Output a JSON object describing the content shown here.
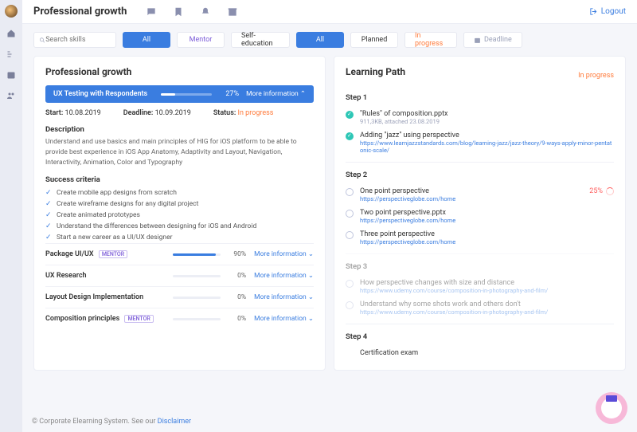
{
  "header": {
    "title": "Professional growth",
    "logout": "Logout"
  },
  "search": {
    "placeholder": "Search skills"
  },
  "filters1": {
    "all": "All",
    "mentor": "Mentor",
    "self": "Self-education"
  },
  "filters2": {
    "all": "All",
    "planned": "Planned",
    "inprog": "In progress",
    "deadline": "Deadline"
  },
  "left": {
    "title": "Professional growth",
    "primary": {
      "name": "UX Testing with Respondents",
      "progress_pct": "27%",
      "progress_val": 27,
      "more": "More information",
      "start_label": "Start:",
      "start": "10.08.2019",
      "deadline_label": "Deadline:",
      "deadline": "10.09.2019",
      "status_label": "Status:",
      "status": "In progress",
      "desc_label": "Description",
      "desc": "Understand and use basics and main principles of HIG for iOS platform to be able to provide best experience in iOS App Anatomy, Adaptivity and Layout, Navigation, Interactivity, Animation, Color and Typography",
      "crit_label": "Success criteria",
      "criteria": [
        "Create mobile app designs from scratch",
        "Create wireframe designs for any digital project",
        "Create animated prototypes",
        "Understand the differences between designing for iOS and Android",
        "Start a new career as a UI/UX designer"
      ]
    },
    "skills": [
      {
        "name": "Package UI/UX",
        "badge": "MENTOR",
        "pct": "90%",
        "val": 90
      },
      {
        "name": "UX Research",
        "badge": "",
        "pct": "0%",
        "val": 0
      },
      {
        "name": "Layout Design Implementation",
        "badge": "",
        "pct": "0%",
        "val": 0
      },
      {
        "name": "Composition principles",
        "badge": "MENTOR",
        "pct": "0%",
        "val": 0
      }
    ],
    "more_info": "More information"
  },
  "right": {
    "title": "Learning Path",
    "status": "In progress",
    "step1_label": "Step 1",
    "step1": [
      {
        "title": "\"Rules\" of composition.pptx",
        "sub": "911,3KB, attached 23.08.2019",
        "done": true,
        "sub_is_link": false
      },
      {
        "title": "Adding \"jazz\" using perspective",
        "sub": "https://www.learnjazzstandards.com/blog/learning-jazz/jazz-theory/9-ways-apply-minor-pentatonic-scale/",
        "done": true,
        "sub_is_link": true
      }
    ],
    "step2_label": "Step 2",
    "step2": [
      {
        "title": "One point perspective",
        "sub": "https://perspectiveglobe.com/home",
        "progress": "25%"
      },
      {
        "title": "Two point perspective.pptx",
        "sub": "https://perspectiveglobe.com/home"
      },
      {
        "title": "Three point perspective",
        "sub": "https://perspectiveglobe.com/home"
      }
    ],
    "step3_label": "Step 3",
    "step3": [
      {
        "title": "How perspective changes with size and distance",
        "sub": "https://www.udemy.com/course/composition-in-photography-and-film/"
      },
      {
        "title": "Understand why some shots work and others don't",
        "sub": "https://www.udemy.com/course/composition-in-photography-and-film/"
      }
    ],
    "step4_label": "Step 4",
    "step4_item": "Certification exam"
  },
  "footer": {
    "text": "© Corporate Elearning System.  See our ",
    "link": "Disclaimer"
  }
}
